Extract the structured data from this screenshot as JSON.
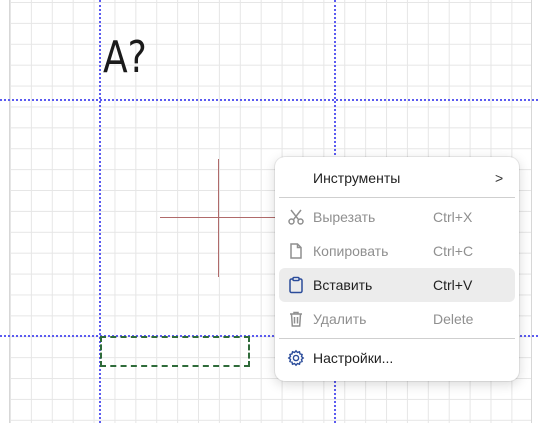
{
  "canvas": {
    "text_label": "A?"
  },
  "context_menu": {
    "tools": {
      "label": "Инструменты",
      "arrow": ">"
    },
    "cut": {
      "label": "Вырезать",
      "shortcut": "Ctrl+X",
      "icon": "scissors-icon",
      "enabled": false
    },
    "copy": {
      "label": "Копировать",
      "shortcut": "Ctrl+C",
      "icon": "copy-icon",
      "enabled": false
    },
    "paste": {
      "label": "Вставить",
      "shortcut": "Ctrl+V",
      "icon": "clipboard-icon",
      "enabled": true,
      "highlighted": true
    },
    "delete": {
      "label": "Удалить",
      "shortcut": "Delete",
      "icon": "trash-icon",
      "enabled": false
    },
    "settings": {
      "label": "Настройки...",
      "icon": "gear-icon"
    }
  },
  "colors": {
    "guide": "#5b5bf0",
    "selection": "#2f6b3a",
    "crosshair": "#b06a6a",
    "accent_icon": "#2b4c9a"
  }
}
